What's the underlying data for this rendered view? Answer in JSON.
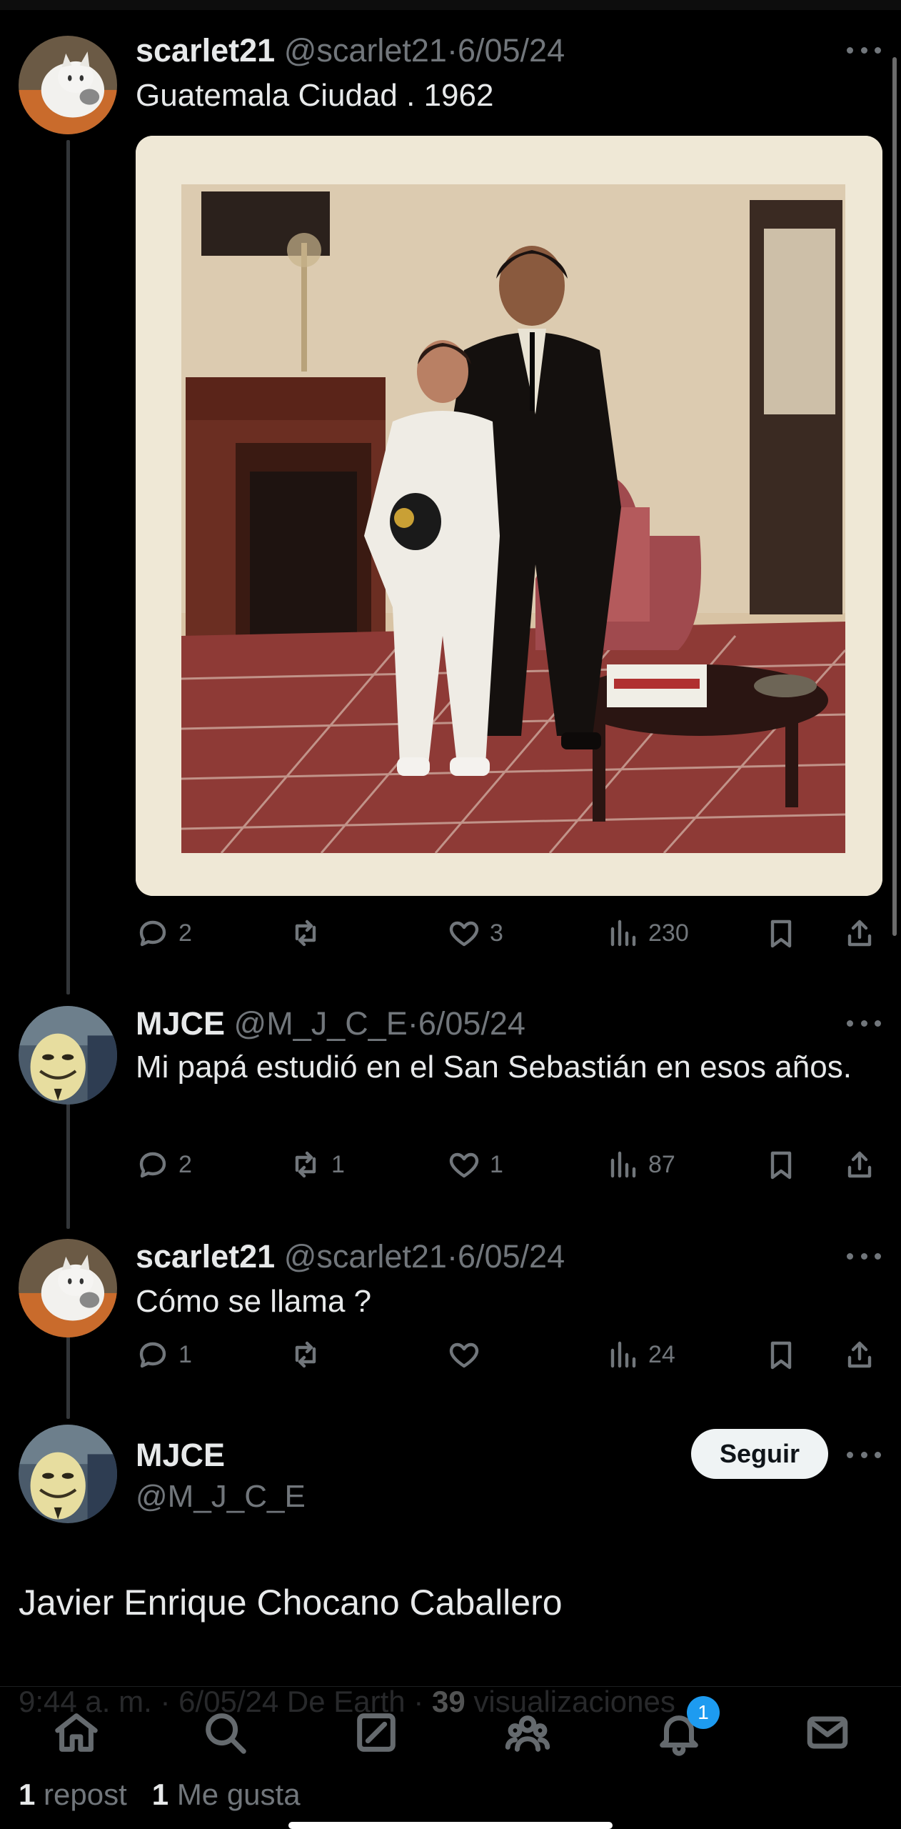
{
  "tweets": [
    {
      "name": "scarlet21",
      "handle": "@scarlet21",
      "date": "6/05/24",
      "text": "Guatemala Ciudad . 1962",
      "replies": "2",
      "reposts": "",
      "likes": "3",
      "views": "230"
    },
    {
      "name": "MJCE",
      "handle": "@M_J_C_E",
      "date": "6/05/24",
      "text": "Mi papá estudió en el San Sebastián en esos años.",
      "replies": "2",
      "reposts": "1",
      "likes": "1",
      "views": "87"
    },
    {
      "name": "scarlet21",
      "handle": "@scarlet21",
      "date": "6/05/24",
      "text": "Cómo se llama ?",
      "replies": "1",
      "reposts": "",
      "likes": "",
      "views": "24"
    }
  ],
  "main": {
    "name": "MJCE",
    "handle": "@M_J_C_E",
    "follow_label": "Seguir",
    "text": "Javier Enrique Chocano Caballero",
    "time": "9:44 a. m.",
    "date": "6/05/24",
    "source": "De Earth",
    "views_count": "39",
    "views_label": "visualizaciones",
    "reposts_count": "1",
    "reposts_label": "repost",
    "likes_count": "1",
    "likes_label": "Me gusta"
  },
  "nav": {
    "items": [
      "home-icon",
      "search-icon",
      "grok-icon",
      "communities-icon",
      "notifications-icon",
      "messages-icon"
    ],
    "notification_badge": "1"
  },
  "separator": "·"
}
